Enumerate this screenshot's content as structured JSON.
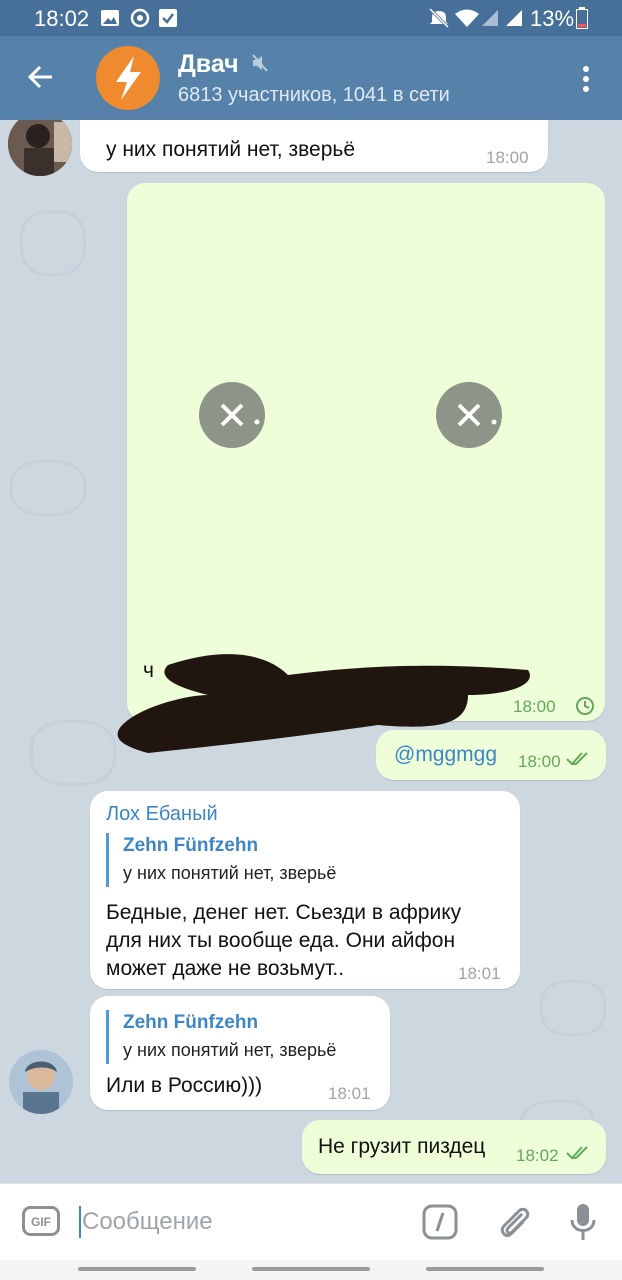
{
  "status_bar": {
    "time": "18:02",
    "battery": "13%",
    "icons": [
      "gallery-icon",
      "sync-icon",
      "check-icon",
      "mute-icon",
      "wifi-icon",
      "signal-icon",
      "battery-icon"
    ]
  },
  "header": {
    "title": "Двач",
    "subtitle": "6813 участников, 1041 в сети",
    "muted": true,
    "avatar_color": "#f08a2e"
  },
  "messages": [
    {
      "type": "incoming",
      "text": "у них понятий нет, зверьё",
      "time": "18:00"
    },
    {
      "type": "outgoing-media",
      "caption_visible": "ч",
      "time": "18:00",
      "status": "pending"
    },
    {
      "type": "outgoing",
      "text": "@mggmgg",
      "time": "18:00",
      "status": "read"
    },
    {
      "type": "incoming",
      "sender": "Лох Ебаный",
      "reply_name": "Zehn Fünfzehn",
      "reply_text": "у них понятий нет, зверьё",
      "text": [
        "Бедные, денег нет. Сьезди в африку",
        "для них ты вообще еда. Они айфон",
        "может даже не возьмут.."
      ],
      "time": "18:01"
    },
    {
      "type": "incoming",
      "reply_name": "Zehn Fünfzehn",
      "reply_text": "у них понятий нет, зверьё",
      "text": "Или в Россию)))",
      "time": "18:01"
    },
    {
      "type": "outgoing",
      "text": "Не грузит пиздец",
      "time": "18:02",
      "status": "read"
    }
  ],
  "input": {
    "placeholder": "Сообщение",
    "gif_label": "GIF"
  },
  "colors": {
    "appbar": "#5682aa",
    "statusbar": "#46709a",
    "out_bubble": "#eefed9",
    "link": "#3d86c6",
    "read_check": "#65a85a"
  }
}
